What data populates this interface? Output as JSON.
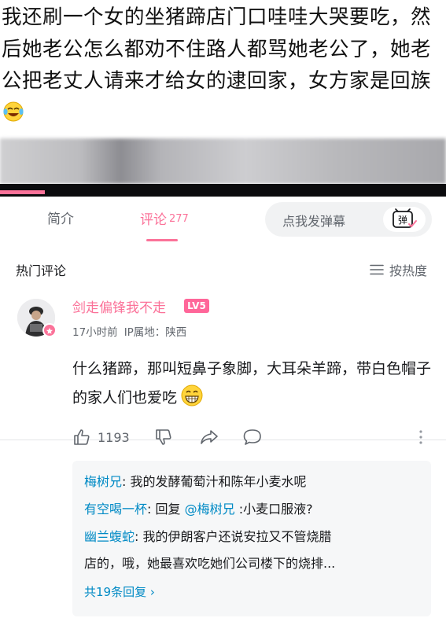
{
  "video": {
    "caption": "我还刷一个女的坐猪蹄店门口哇哇大哭要吃，然后她老公怎么都劝不住路人都骂她老公了，她老公把老丈人请来才给女的逮回家，女方家是回族",
    "caption_emoji": "laughing-tears-emoji",
    "progress_fraction": 0.1
  },
  "tabs": {
    "intro_label": "简介",
    "comments_label": "评论",
    "comments_count": "277",
    "danmaku_placeholder": "点我发弹幕",
    "danmaku_icon": "弹"
  },
  "comments_header": {
    "title": "热门评论",
    "sort_label": "按热度"
  },
  "comment": {
    "username": "剑走偏锋我不走",
    "level": "LV5",
    "time": "17小时前",
    "location": "IP属地：陕西",
    "text": "什么猪蹄，那叫短鼻子象脚，大耳朵羊蹄，带白色帽子的家人们也爱吃",
    "text_emoji": "grinning-emoji",
    "likes": "1193"
  },
  "replies": [
    {
      "name": "梅树兄",
      "text": ": 我的发酵葡萄汁和陈年小麦水呢"
    },
    {
      "name": "有空喝一杯",
      "text_prefix": ": 回复 ",
      "mention": "@梅树兄",
      "text": " :小麦口服液?"
    },
    {
      "name": "幽兰蝮蛇",
      "text": ": 我的伊朗客户还说安拉又不管烧腊",
      "text_line2": "店的，哦，她最喜欢吃她们公司楼下的烧排..."
    }
  ],
  "see_more": "共19条回复 ›",
  "colors": {
    "accent": "#fb7299",
    "link": "#008ac5",
    "level_badge": "#ff6699"
  }
}
